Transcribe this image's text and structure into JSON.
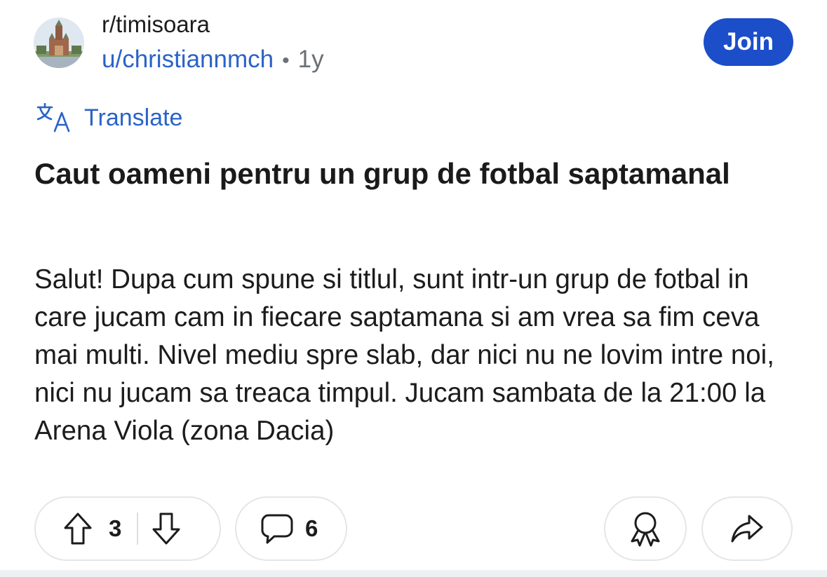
{
  "header": {
    "subreddit": "r/timisoara",
    "username": "u/christiannmch",
    "separator": "•",
    "age": "1y",
    "join_label": "Join"
  },
  "translate": {
    "icon": "translate-icon",
    "label": "Translate"
  },
  "post": {
    "title": "Caut oameni pentru un grup de fotbal saptamanal",
    "body": "Salut! Dupa cum spune si titlul, sunt intr-un grup de fotbal in care jucam cam in fiecare saptamana si am vrea sa fim ceva mai multi. Nivel mediu spre slab, dar nici nu ne lovim intre noi, nici nu jucam sa treaca timpul. Jucam sambata de la 21:00 la Arena Viola (zona Dacia)"
  },
  "actions": {
    "upvote_icon": "arrow-up-icon",
    "vote_count": "3",
    "downvote_icon": "arrow-down-icon",
    "comment_icon": "speech-bubble-icon",
    "comment_count": "6",
    "award_icon": "award-icon",
    "share_icon": "share-icon"
  },
  "colors": {
    "accent_blue": "#1c4ec9",
    "link_blue": "#2a63c7",
    "text": "#1a1a1b",
    "meta_gray": "#6b7075",
    "pill_border": "#e3e6e8"
  }
}
